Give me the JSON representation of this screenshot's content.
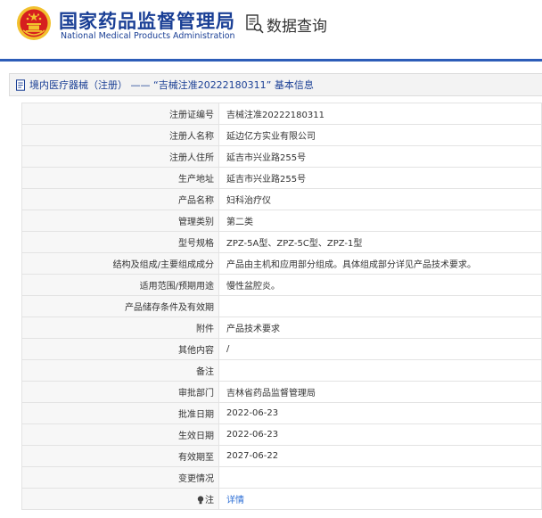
{
  "header": {
    "org_name_cn": "国家药品监督管理局",
    "org_name_en": "National Medical Products Administration",
    "query_label": "数据查询",
    "emblem_icon": "national-emblem-icon",
    "query_icon": "document-search-icon"
  },
  "section": {
    "title": "境内医疗器械（注册）  ——  “吉械注准20222180311”  基本信息",
    "icon": "document-icon"
  },
  "colors": {
    "brand_blue": "#1a3f95",
    "header_line": "#2d5db8",
    "link": "#2d6fd6",
    "emblem_red": "#d61f1f",
    "emblem_gold": "#f2c12e"
  },
  "rows": [
    {
      "label": "注册证编号",
      "value": "吉械注准20222180311"
    },
    {
      "label": "注册人名称",
      "value": "延边亿方实业有限公司"
    },
    {
      "label": "注册人住所",
      "value": "延吉市兴业路255号"
    },
    {
      "label": "生产地址",
      "value": "延吉市兴业路255号"
    },
    {
      "label": "产品名称",
      "value": "妇科治疗仪"
    },
    {
      "label": "管理类别",
      "value": "第二类"
    },
    {
      "label": "型号规格",
      "value": "ZPZ-5A型、ZPZ-5C型、ZPZ-1型"
    },
    {
      "label": "结构及组成/主要组成成分",
      "value": "产品由主机和应用部分组成。具体组成部分详见产品技术要求。"
    },
    {
      "label": "适用范围/预期用途",
      "value": "慢性盆腔炎。"
    },
    {
      "label": "产品储存条件及有效期",
      "value": ""
    },
    {
      "label": "附件",
      "value": "产品技术要求"
    },
    {
      "label": "其他内容",
      "value": "/"
    },
    {
      "label": "备注",
      "value": ""
    },
    {
      "label": "审批部门",
      "value": "吉林省药品监督管理局"
    },
    {
      "label": "批准日期",
      "value": "2022-06-23"
    },
    {
      "label": "生效日期",
      "value": "2022-06-23"
    },
    {
      "label": "有效期至",
      "value": "2027-06-22"
    },
    {
      "label": "变更情况",
      "value": ""
    },
    {
      "label": "注",
      "value": "详情",
      "icon": "lightbulb-icon"
    }
  ]
}
